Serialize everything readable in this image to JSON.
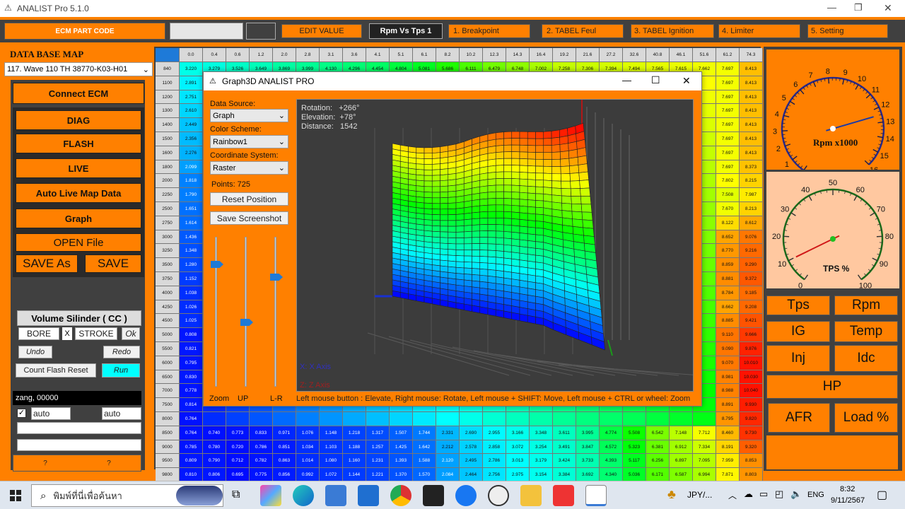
{
  "app": {
    "title": "ANALIST Pro 5.1.0",
    "min": "—",
    "max": "❐",
    "close": "✕"
  },
  "toolbar": {
    "ecm_label": "ECM PART CODE",
    "edit_value": "EDIT VALUE",
    "rpm_vs_tps": "Rpm Vs Tps 1",
    "tabs": [
      "1. Breakpoint",
      "2. TABEL Feul",
      "3. TABEL Ignition",
      "4. Limiter",
      "5. Setting"
    ]
  },
  "sidebar": {
    "db_title": "DATA BASE MAP",
    "db_selected": "117. Wave 110 TH 38770-K03-H01",
    "connect": "Connect ECM",
    "buttons": [
      "DIAG",
      "FLASH",
      "LIVE",
      "Auto Live Map Data",
      "Graph",
      "OPEN File"
    ],
    "save_as": "SAVE As",
    "save": "SAVE",
    "volume_title": "Volume Silinder ( CC )",
    "bore": "BORE",
    "x": "X",
    "stroke": "STROKE",
    "ok": "Ok",
    "undo": "Undo",
    "redo": "Redo",
    "count_flash": "Count Flash Reset",
    "run": "Run",
    "status": "zang, 00000",
    "auto1": "auto",
    "auto2": "auto",
    "q1": "?",
    "q2": "?"
  },
  "table": {
    "cols": [
      "0.0",
      "0.4",
      "0.6",
      "1.2",
      "2.0",
      "2.8",
      "3.1",
      "3.6",
      "4.1",
      "5.1",
      "6.1",
      "8.2",
      "10.2",
      "12.3",
      "14.3",
      "16.4",
      "19.2",
      "21.6",
      "27.2",
      "32.6",
      "40.8",
      "46.1",
      "51.6",
      "61.2",
      "74.3"
    ],
    "rows": [
      "840",
      "1100",
      "1200",
      "1300",
      "1400",
      "1500",
      "1600",
      "1800",
      "2000",
      "2250",
      "2500",
      "2750",
      "3000",
      "3250",
      "3500",
      "3750",
      "4000",
      "4250",
      "4500",
      "5000",
      "5500",
      "6000",
      "6500",
      "7000",
      "7500",
      "8000",
      "8500",
      "9000",
      "9500",
      "9800"
    ],
    "row0_visible": [
      "3.220",
      "3.279",
      "3.526",
      "3.649",
      "3.869",
      "3.999",
      "4.130",
      "4.296",
      "4.454",
      "4.804",
      "5.081",
      "5.686",
      "6.111",
      "6.479",
      "6.748",
      "7.002",
      "7.258",
      "7.306",
      "7.394",
      "7.494",
      "7.565",
      "7.615",
      "7.662",
      "7.697",
      "8.413"
    ],
    "col0_visible": [
      "3.220",
      "2.891",
      "2.751",
      "2.610",
      "2.449",
      "2.356",
      "2.276",
      "2.099",
      "1.818",
      "1.790",
      "1.651",
      "1.614",
      "1.436",
      "1.348",
      "1.280",
      "1.152",
      "1.038",
      "1.026",
      "1.025",
      "0.808",
      "0.821",
      "0.795",
      "0.830",
      "0.778",
      "0.814",
      "0.764",
      "0.785",
      "0.809",
      "0.810",
      "0.785"
    ],
    "right_cols": [
      [
        "7.697",
        "8.413"
      ],
      [
        "7.697",
        "8.413"
      ],
      [
        "7.697",
        "8.413"
      ],
      [
        "7.697",
        "8.413"
      ],
      [
        "7.697",
        "8.413"
      ],
      [
        "7.697",
        "8.413"
      ],
      [
        "7.697",
        "8.373"
      ],
      [
        "7.802",
        "8.215"
      ],
      [
        "7.508",
        "7.987"
      ],
      [
        "7.670",
        "8.213"
      ],
      [
        "8.122",
        "8.612"
      ],
      [
        "8.652",
        "9.076"
      ],
      [
        "8.770",
        "9.216"
      ],
      [
        "8.859",
        "9.290"
      ],
      [
        "8.881",
        "9.372"
      ],
      [
        "8.784",
        "9.185"
      ],
      [
        "8.662",
        "9.208"
      ],
      [
        "8.885",
        "9.421"
      ],
      [
        "9.110",
        "9.666"
      ],
      [
        "9.090",
        "9.876"
      ],
      [
        "9.070",
        "10.010"
      ],
      [
        "8.981",
        "10.030"
      ],
      [
        "8.988",
        "10.040"
      ],
      [
        "8.891",
        "9.930"
      ],
      [
        "8.795",
        "9.820"
      ],
      [
        "8.460",
        "9.730"
      ],
      [
        "8.191",
        "9.320"
      ],
      [
        "7.959",
        "8.853"
      ],
      [
        "7.871",
        "8.803"
      ]
    ],
    "bottom_rows": [
      {
        "rpm": "8500",
        "vals": [
          "0.764",
          "0.740",
          "0.773",
          "0.833",
          "0.971",
          "1.076",
          "1.148",
          "1.218",
          "1.317",
          "1.507",
          "1.744",
          "2.331",
          "2.690",
          "2.955",
          "3.166",
          "3.348",
          "3.611",
          "3.995",
          "4.774",
          "5.508",
          "6.542",
          "7.148",
          "7.712",
          "8.460",
          "9.730"
        ]
      },
      {
        "rpm": "9000",
        "vals": [
          "0.785",
          "0.780",
          "0.720",
          "0.786",
          "0.851",
          "1.034",
          "1.103",
          "1.188",
          "1.257",
          "1.425",
          "1.642",
          "2.212",
          "2.578",
          "2.858",
          "3.072",
          "3.254",
          "3.491",
          "3.847",
          "4.572",
          "5.323",
          "6.381",
          "6.912",
          "7.334",
          "8.191",
          "9.320"
        ]
      },
      {
        "rpm": "9500",
        "vals": [
          "0.809",
          "0.790",
          "0.712",
          "0.782",
          "0.863",
          "1.014",
          "1.080",
          "1.160",
          "1.231",
          "1.393",
          "1.588",
          "2.120",
          "2.495",
          "2.786",
          "3.013",
          "3.179",
          "3.424",
          "3.733",
          "4.393",
          "5.117",
          "6.256",
          "6.897",
          "7.095",
          "7.959",
          "8.853"
        ]
      },
      {
        "rpm": "9800",
        "vals": [
          "0.810",
          "0.806",
          "0.695",
          "0.775",
          "0.856",
          "0.992",
          "1.072",
          "1.144",
          "1.221",
          "1.370",
          "1.570",
          "2.084",
          "2.464",
          "2.756",
          "2.975",
          "3.154",
          "3.384",
          "3.692",
          "4.340",
          "5.036",
          "6.171",
          "6.587",
          "6.994",
          "7.871",
          "8.803"
        ]
      }
    ]
  },
  "graph3d": {
    "title": "Graph3D ANALIST PRO",
    "data_source_label": "Data Source:",
    "data_source": "Graph",
    "color_scheme_label": "Color Scheme:",
    "color_scheme": "Rainbow1",
    "coord_label": "Coordinate System:",
    "coord": "Raster",
    "points": "Points: 725",
    "reset": "Reset Position",
    "screenshot": "Save Screenshot",
    "zoom": "Zoom",
    "up": "UP",
    "lr": "L-R",
    "rotation": "Rotation:   +266°",
    "elevation": "Elevation:  +78°",
    "distance": "Distance:   1542",
    "x_axis": "X: X Axis",
    "z_axis": "Z: Z Axis",
    "hint": "Left mouse button : Elevate,  Right mouse: Rotate,  Left mouse + SHIFT: Move,  Left mouse + CTRL or wheel: Zoom",
    "min": "—",
    "max": "☐",
    "close": "✕"
  },
  "gauges": {
    "rpm": {
      "label": "Rpm x1000",
      "ticks": [
        "0",
        "1",
        "2",
        "3",
        "4",
        "5",
        "6",
        "7",
        "8",
        "9",
        "10",
        "11",
        "12",
        "13",
        "14",
        "15",
        "16"
      ],
      "value": 12.5
    },
    "tps": {
      "label": "TPS %",
      "ticks": [
        "0",
        "10",
        "20",
        "30",
        "40",
        "50",
        "60",
        "70",
        "80",
        "90",
        "100"
      ],
      "value": 10
    }
  },
  "right_buttons": {
    "tps": "Tps",
    "rpm": "Rpm",
    "ig": "IG",
    "temp": "Temp",
    "inj": "Inj",
    "idc": "Idc",
    "hp": "HP",
    "afr": "AFR",
    "load": "Load %"
  },
  "taskbar": {
    "search": "พิมพ์ที่นี่เพื่อค้นหา",
    "currency": "JPY/...",
    "lang": "ENG",
    "time": "8:32",
    "date": "9/11/2567"
  }
}
